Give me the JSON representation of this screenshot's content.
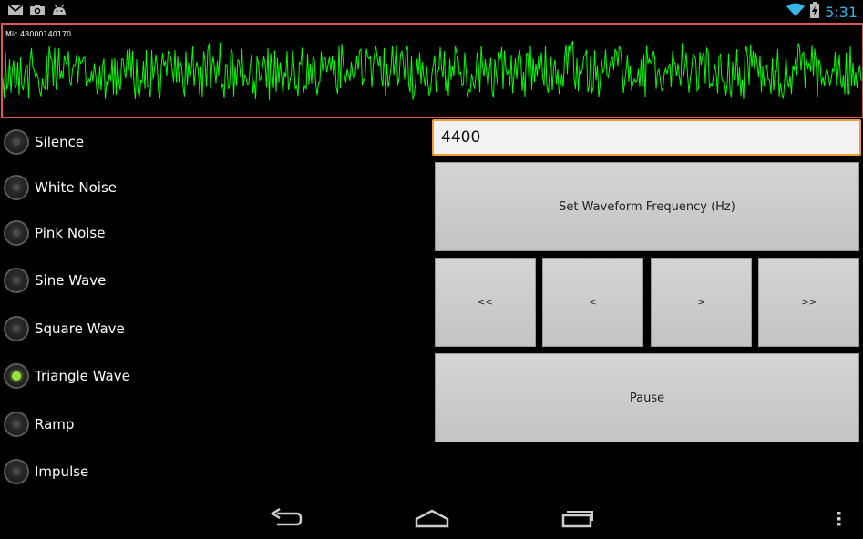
{
  "status_bar": {
    "time": "5:31",
    "icons": [
      "gmail-icon",
      "camera-icon",
      "android-icon",
      "wifi-icon",
      "battery-charging-icon"
    ]
  },
  "waveform": {
    "label": "Mic 48000140170",
    "color": "#00ff00"
  },
  "waveforms": [
    {
      "label": "Silence",
      "selected": false
    },
    {
      "label": "White Noise",
      "selected": false
    },
    {
      "label": "Pink Noise",
      "selected": false
    },
    {
      "label": "Sine Wave",
      "selected": false
    },
    {
      "label": "Square Wave",
      "selected": false
    },
    {
      "label": "Triangle Wave",
      "selected": true
    },
    {
      "label": "Ramp",
      "selected": false
    },
    {
      "label": "Impulse",
      "selected": false
    }
  ],
  "frequency": {
    "value": "4400"
  },
  "buttons": {
    "set_frequency": "Set Waveform Frequency (Hz)",
    "fast_back": "<<",
    "back": "<",
    "forward": ">",
    "fast_forward": ">>",
    "pause": "Pause"
  },
  "colors": {
    "accent_orange": "#f39c2f",
    "radio_selected": "#9be23a",
    "wave_border": "#e05555",
    "clock": "#33b5e5"
  },
  "nav_icons": [
    "back-icon",
    "home-icon",
    "recents-icon",
    "overflow-menu-icon"
  ]
}
